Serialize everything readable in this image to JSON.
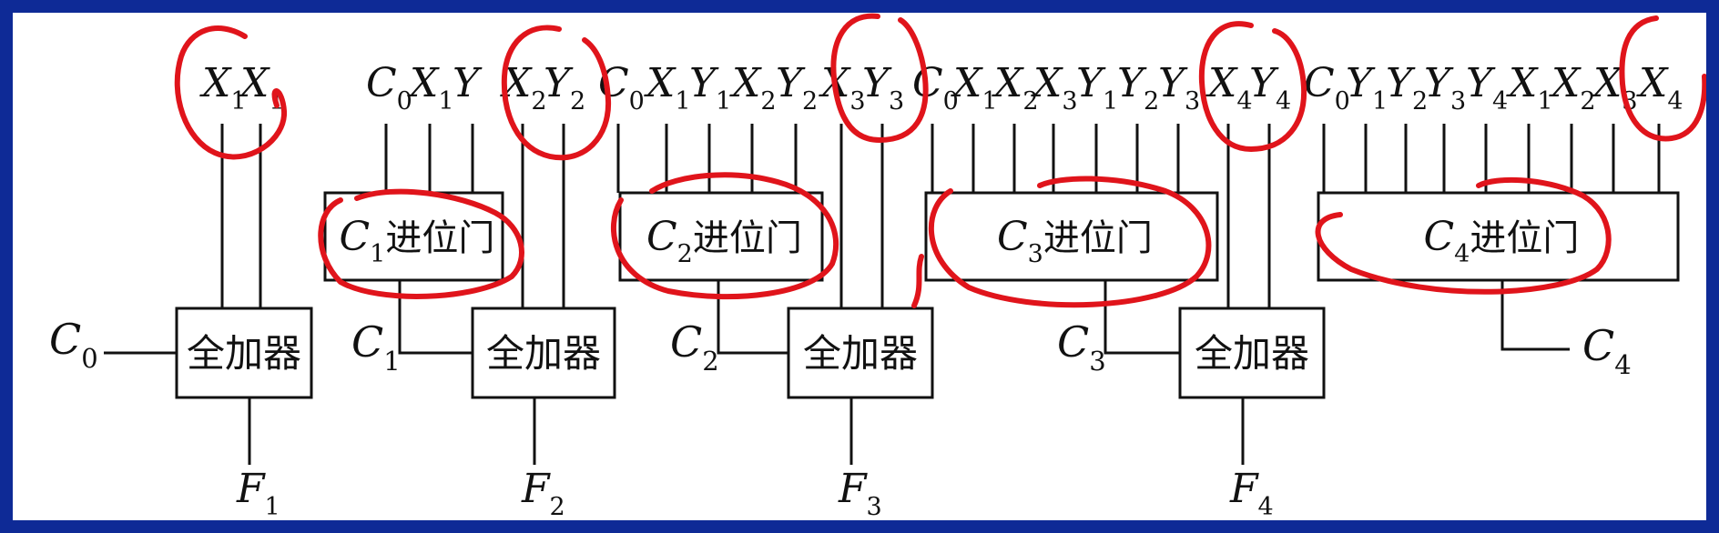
{
  "diagram": {
    "input_groups": [
      {
        "labels": [
          [
            "X",
            "1"
          ],
          [
            "X",
            "1"
          ]
        ]
      },
      {
        "labels": [
          [
            "C",
            "0"
          ],
          [
            "X",
            "1"
          ],
          [
            "Y",
            ""
          ],
          [
            "X",
            "2"
          ],
          [
            "Y",
            "2"
          ]
        ]
      },
      {
        "labels": [
          [
            "C",
            "0"
          ],
          [
            "X",
            "1"
          ],
          [
            "Y",
            "1"
          ],
          [
            "X",
            "2"
          ],
          [
            "Y",
            "2"
          ],
          [
            "X",
            "3"
          ],
          [
            "Y",
            "3"
          ]
        ]
      },
      {
        "labels": [
          [
            "C",
            "0"
          ],
          [
            "X",
            "1"
          ],
          [
            "X",
            "2"
          ],
          [
            "X",
            "3"
          ],
          [
            "Y",
            "1"
          ],
          [
            "Y",
            "2"
          ],
          [
            "Y",
            "3"
          ],
          [
            "X",
            "4"
          ],
          [
            "Y",
            "4"
          ]
        ]
      },
      {
        "labels": [
          [
            "C",
            "0"
          ],
          [
            "Y",
            "1"
          ],
          [
            "Y",
            "2"
          ],
          [
            "Y",
            "3"
          ],
          [
            "Y",
            "4"
          ],
          [
            "X",
            "1"
          ],
          [
            "X",
            "2"
          ],
          [
            "X",
            "3"
          ],
          [
            "X",
            "4"
          ]
        ]
      }
    ],
    "carry_gates": [
      {
        "main": "C",
        "sub": "1",
        "suffix": "进位门"
      },
      {
        "main": "C",
        "sub": "2",
        "suffix": "进位门"
      },
      {
        "main": "C",
        "sub": "3",
        "suffix": "进位门"
      },
      {
        "main": "C",
        "sub": "4",
        "suffix": "进位门"
      }
    ],
    "full_adder_label": "全加器",
    "carry_labels": [
      {
        "main": "C",
        "sub": "0"
      },
      {
        "main": "C",
        "sub": "1"
      },
      {
        "main": "C",
        "sub": "2"
      },
      {
        "main": "C",
        "sub": "3"
      },
      {
        "main": "C",
        "sub": "4"
      }
    ],
    "outputs": [
      {
        "main": "F",
        "sub": "1"
      },
      {
        "main": "F",
        "sub": "2"
      },
      {
        "main": "F",
        "sub": "3"
      },
      {
        "main": "F",
        "sub": "4"
      }
    ],
    "colors": {
      "background": "#0e2a96",
      "panel": "#ffffff",
      "line": "#111111",
      "annotation": "#e0141b"
    }
  }
}
